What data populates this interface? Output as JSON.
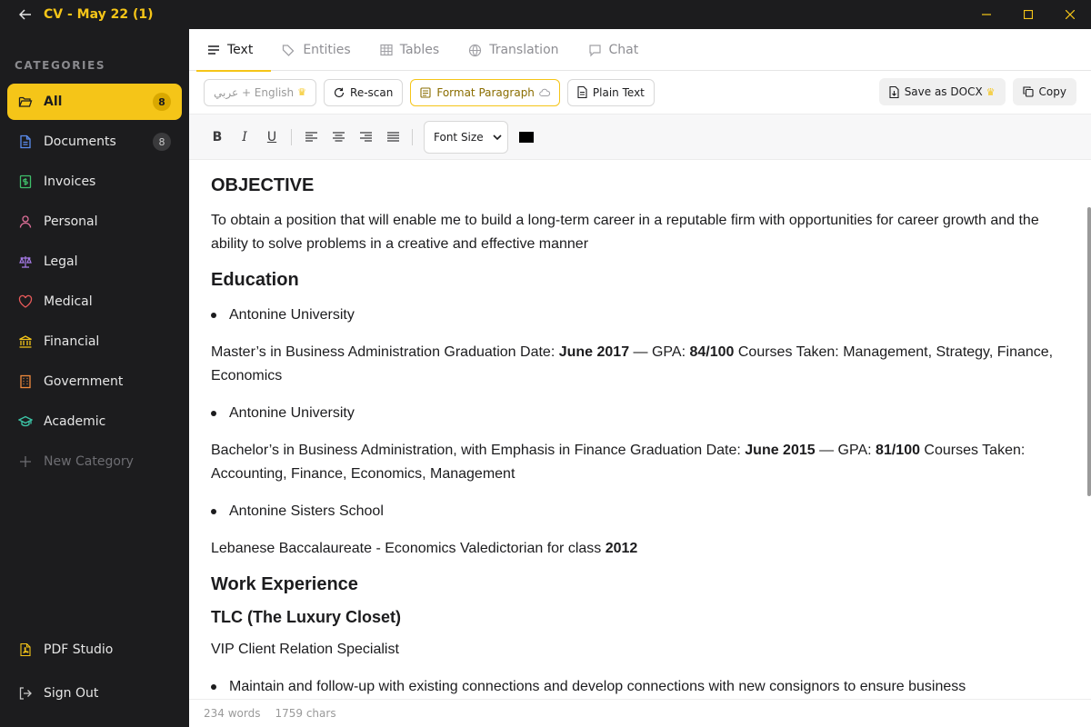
{
  "window": {
    "title": "CV - May 22 (1)",
    "accent": "#f5c518"
  },
  "sidebar": {
    "heading": "CATEGORIES",
    "items": [
      {
        "label": "All",
        "count": "8",
        "icon": "folder-open-icon",
        "active": true
      },
      {
        "label": "Documents",
        "count": "8",
        "icon": "document-icon"
      },
      {
        "label": "Invoices",
        "icon": "invoice-icon"
      },
      {
        "label": "Personal",
        "icon": "person-icon"
      },
      {
        "label": "Legal",
        "icon": "scales-icon"
      },
      {
        "label": "Medical",
        "icon": "heart-icon"
      },
      {
        "label": "Financial",
        "icon": "bank-icon"
      },
      {
        "label": "Government",
        "icon": "building-icon"
      },
      {
        "label": "Academic",
        "icon": "graduation-cap-icon"
      },
      {
        "label": "New Category",
        "icon": "plus-icon"
      }
    ],
    "bottom": {
      "pdf_studio": "PDF Studio",
      "sign_out": "Sign Out"
    }
  },
  "tabs": [
    {
      "label": "Text",
      "icon": "lines-icon",
      "active": true
    },
    {
      "label": "Entities",
      "icon": "tag-icon"
    },
    {
      "label": "Tables",
      "icon": "table-icon"
    },
    {
      "label": "Translation",
      "icon": "globe-icon"
    },
    {
      "label": "Chat",
      "icon": "chat-icon"
    }
  ],
  "toolbar": {
    "language": "عربي + English",
    "rescan": "Re-scan",
    "format_paragraph": "Format Paragraph",
    "plain_text": "Plain Text",
    "save_docx": "Save as DOCX",
    "copy": "Copy"
  },
  "format_bar": {
    "bold": "B",
    "italic": "I",
    "underline": "U",
    "font_size": "Font Size",
    "text_color": "#000000"
  },
  "document": {
    "objective_heading": "OBJECTIVE",
    "objective_text": "To obtain a position that will enable me to build a long-term career in a reputable firm with opportunities for career growth and the ability to solve problems in a creative and effective manner",
    "education_heading": "Education",
    "edu1_school": "Antonine University",
    "edu1_a": "Master’s in Business Administration Graduation Date: ",
    "edu1_date": "June 2017",
    "edu1_b": " — GPA: ",
    "edu1_gpa": "84/100",
    "edu1_c": " Courses Taken: Management, Strategy, Finance, Economics",
    "edu2_school": "Antonine University",
    "edu2_a": "Bachelor’s in Business Administration, with Emphasis in Finance Graduation Date: ",
    "edu2_date": "June 2015",
    "edu2_b": " — GPA: ",
    "edu2_gpa": "81/100",
    "edu2_c": " Courses Taken: Accounting, Finance, Economics, Management",
    "edu3_school": "Antonine Sisters School",
    "edu3_a": "Lebanese Baccalaureate - Economics Valedictorian for class ",
    "edu3_year": "2012",
    "work_heading": "Work Experience",
    "company": "TLC (The Luxury Closet)",
    "role": "VIP Client Relation Specialist",
    "duty1": "Maintain and follow-up with existing connections and develop connections with new consignors to ensure business"
  },
  "status": {
    "words": "234 words",
    "chars": "1759 chars"
  }
}
